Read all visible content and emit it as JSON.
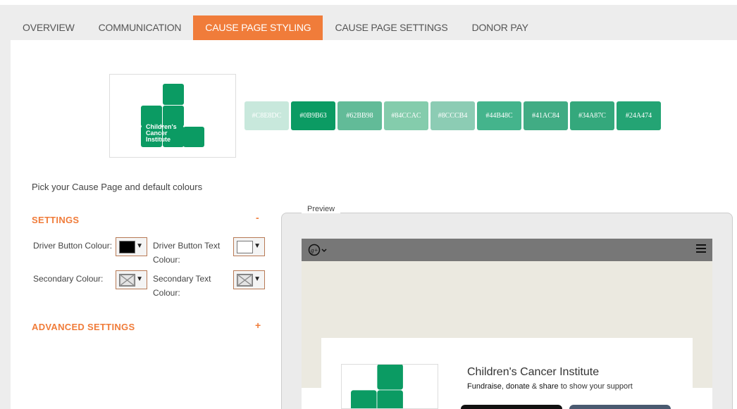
{
  "tabs": [
    {
      "label": "OVERVIEW",
      "active": false
    },
    {
      "label": "COMMUNICATION",
      "active": false
    },
    {
      "label": "CAUSE PAGE STYLING",
      "active": true
    },
    {
      "label": "CAUSE PAGE SETTINGS",
      "active": false
    },
    {
      "label": "DONOR PAY",
      "active": false
    }
  ],
  "logo": {
    "line1": "Children's",
    "line2": "Cancer",
    "line3": "Institute",
    "color": "#0B9B63"
  },
  "swatches": [
    {
      "label": "#C8E8DC",
      "color": "#C8E8DC"
    },
    {
      "label": "#0B9B63",
      "color": "#0B9B63"
    },
    {
      "label": "#62BB98",
      "color": "#62BB98"
    },
    {
      "label": "#84CCAC",
      "color": "#84CCAC"
    },
    {
      "label": "#8CCCB4",
      "color": "#8CCCB4"
    },
    {
      "label": "#44B48C",
      "color": "#44B48C"
    },
    {
      "label": "#41AC84",
      "color": "#41AC84"
    },
    {
      "label": "#34A87C",
      "color": "#34A87C"
    },
    {
      "label": "#24A474",
      "color": "#24A474"
    }
  ],
  "pick_text": "Pick your Cause Page and default colours",
  "settings": {
    "title": "SETTINGS",
    "toggle": "-",
    "driver_button_colour_label": "Driver Button Colour:",
    "driver_button_text_colour_label_1": "Driver Button Text",
    "driver_button_text_colour_label_2": "Colour:",
    "secondary_colour_label": "Secondary Colour:",
    "secondary_text_colour_label_1": "Secondary Text",
    "secondary_text_colour_label_2": "Colour:",
    "driver_button_colour": "#000000",
    "driver_button_text_colour": "#ffffff",
    "caret": "▼"
  },
  "advanced": {
    "title": "ADVANCED SETTINGS",
    "toggle": "+"
  },
  "preview": {
    "legend": "Preview",
    "brand_icon": "jg-logo-icon",
    "menu_icon": "hamburger-icon",
    "title": "Children's Cancer Institute",
    "sub_1": "Fundraise",
    "sub_sep": ", ",
    "sub_2": "donate",
    "sub_amp": " & ",
    "sub_3": "share",
    "sub_rest": " to show your support"
  },
  "colors": {
    "accent": "#f07c3a"
  }
}
